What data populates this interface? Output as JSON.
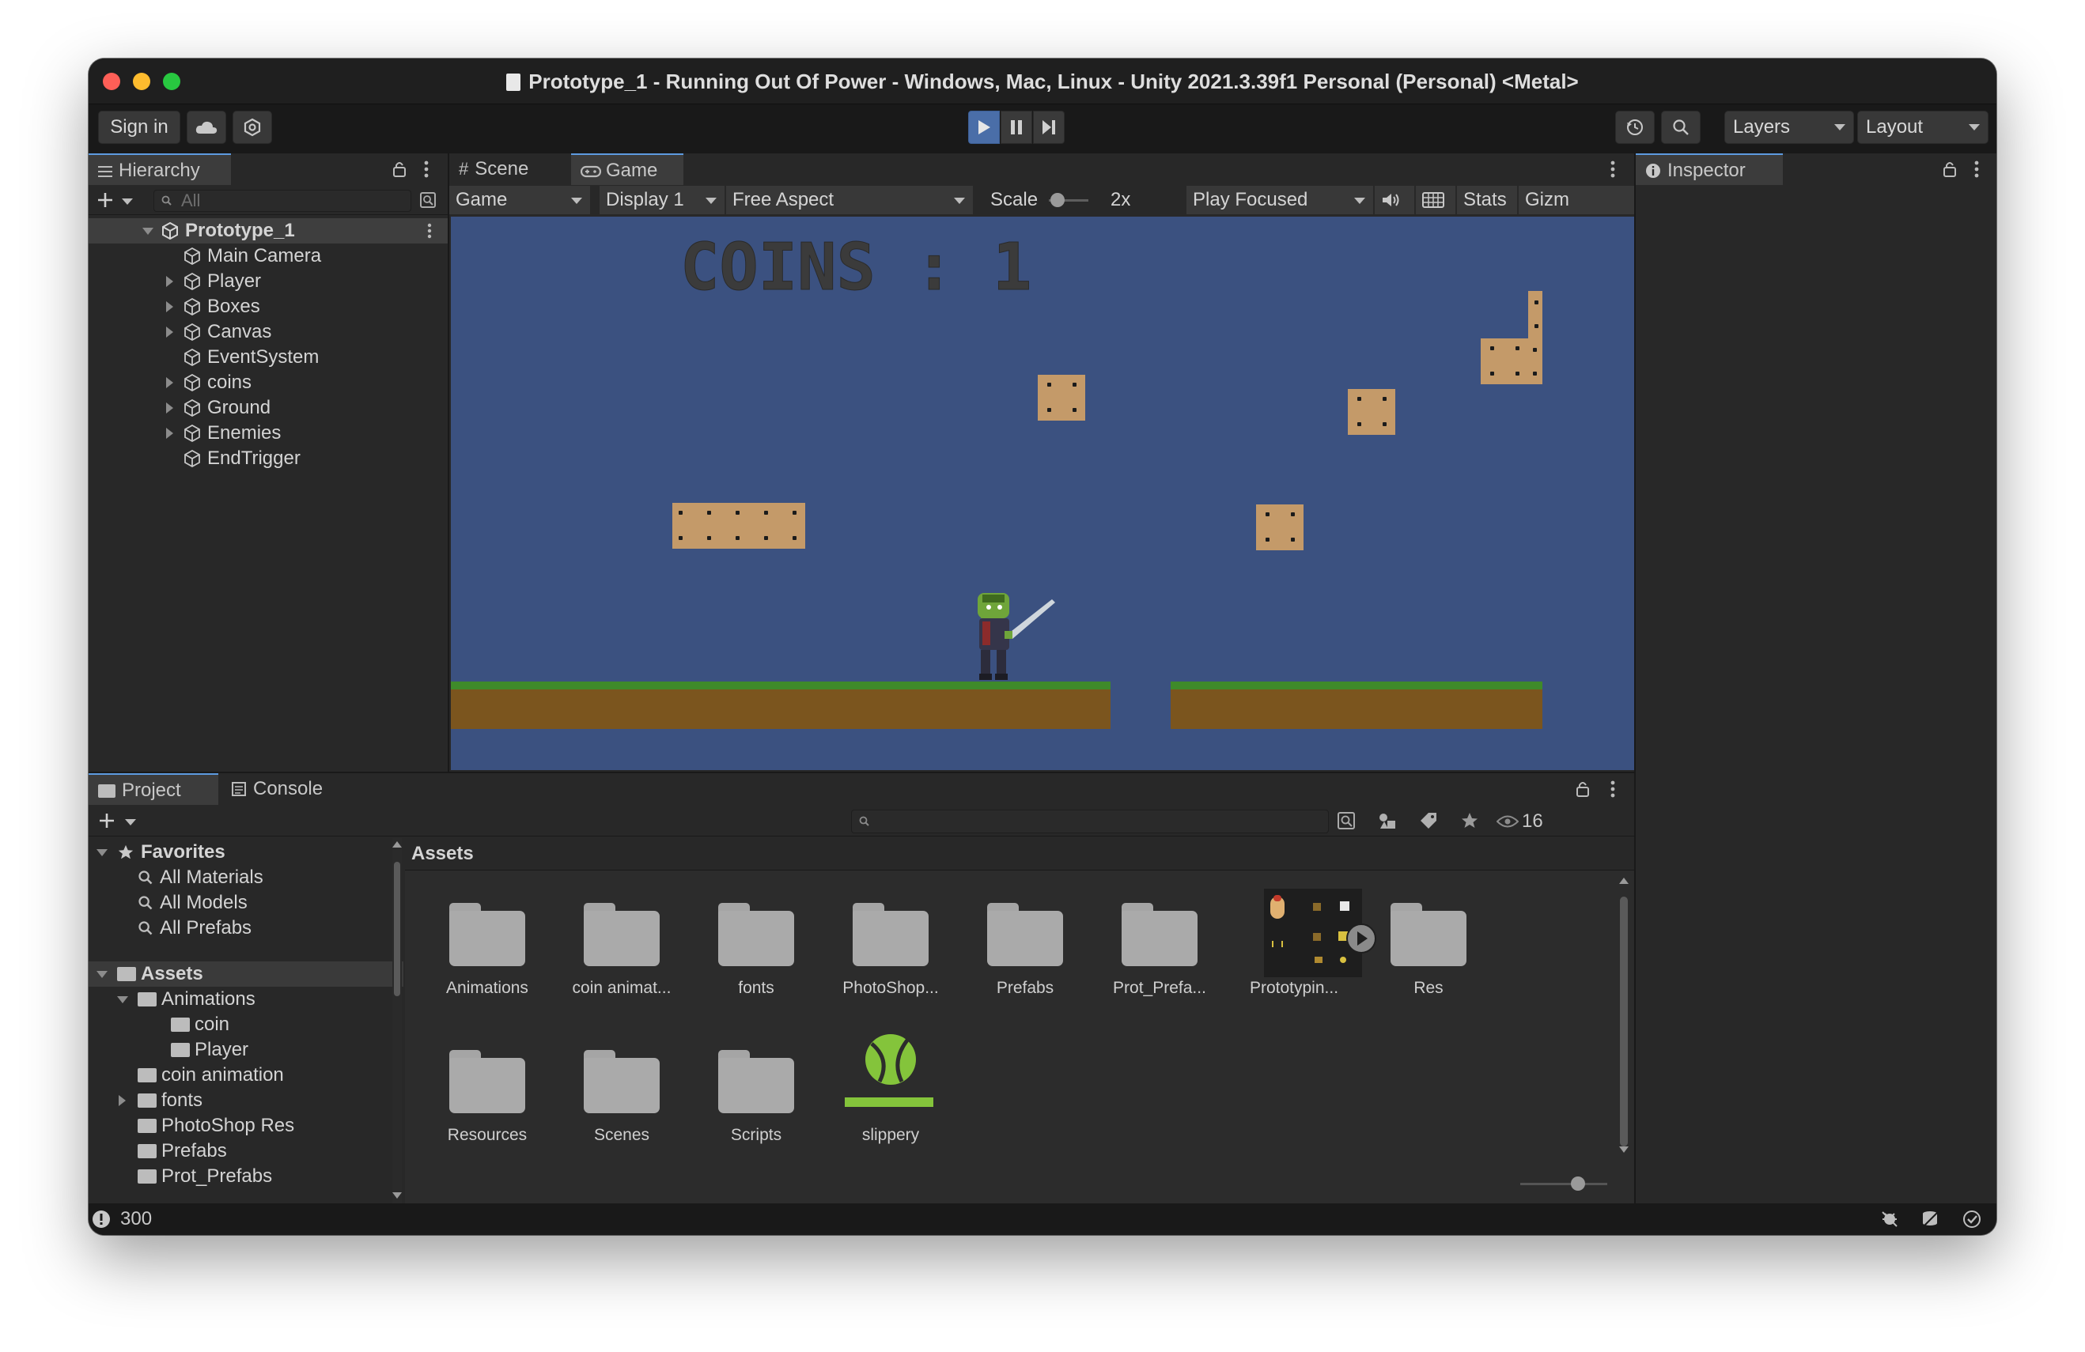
{
  "window": {
    "title": "Prototype_1 - Running Out Of Power - Windows, Mac, Linux - Unity 2021.3.39f1 Personal (Personal) <Metal>"
  },
  "toolbar": {
    "sign_in": "Sign in",
    "layers": "Layers",
    "layout": "Layout"
  },
  "hierarchy": {
    "tab": "Hierarchy",
    "search_placeholder": "All",
    "scene_name": "Prototype_1",
    "items": [
      {
        "label": "Main Camera",
        "expandable": false
      },
      {
        "label": "Player",
        "expandable": true
      },
      {
        "label": "Boxes",
        "expandable": true
      },
      {
        "label": "Canvas",
        "expandable": true
      },
      {
        "label": "EventSystem",
        "expandable": false
      },
      {
        "label": "coins",
        "expandable": true
      },
      {
        "label": "Ground",
        "expandable": true
      },
      {
        "label": "Enemies",
        "expandable": true
      },
      {
        "label": "EndTrigger",
        "expandable": false
      }
    ]
  },
  "game_view": {
    "tabs": [
      "Scene",
      "Game"
    ],
    "active_tab": "Game",
    "mode": "Game",
    "display": "Display 1",
    "aspect": "Free Aspect",
    "scale_label": "Scale",
    "scale_value": "2x",
    "play_mode": "Play Focused",
    "stats": "Stats",
    "gizmos": "Gizm",
    "hud_text": "COINS : 1",
    "sky_color": "#3b5180",
    "grass_color": "#3f8a2a",
    "dirt_color": "#7b551e",
    "box_color": "#c49a69"
  },
  "inspector": {
    "tab": "Inspector"
  },
  "project": {
    "tabs": [
      "Project",
      "Console"
    ],
    "hidden_count": "16",
    "breadcrumb": "Assets",
    "favorites": {
      "label": "Favorites",
      "items": [
        "All Materials",
        "All Models",
        "All Prefabs"
      ]
    },
    "tree": {
      "root": "Assets",
      "items": [
        {
          "label": "Animations",
          "depth": 1,
          "expanded": true
        },
        {
          "label": "coin",
          "depth": 2
        },
        {
          "label": "Player",
          "depth": 2
        },
        {
          "label": "coin animation",
          "depth": 1
        },
        {
          "label": "fonts",
          "depth": 1,
          "expandable": true
        },
        {
          "label": "PhotoShop Res",
          "depth": 1
        },
        {
          "label": "Prefabs",
          "depth": 1
        },
        {
          "label": "Prot_Prefabs",
          "depth": 1
        }
      ]
    },
    "assets": [
      {
        "label": "Animations",
        "kind": "folder"
      },
      {
        "label": "coin animat...",
        "kind": "folder"
      },
      {
        "label": "fonts",
        "kind": "folder"
      },
      {
        "label": "PhotoShop...",
        "kind": "folder"
      },
      {
        "label": "Prefabs",
        "kind": "folder"
      },
      {
        "label": "Prot_Prefa...",
        "kind": "folder"
      },
      {
        "label": "Prototypin...",
        "kind": "sprite-sheet"
      },
      {
        "label": "Res",
        "kind": "folder"
      },
      {
        "label": "Resources",
        "kind": "folder"
      },
      {
        "label": "Scenes",
        "kind": "folder"
      },
      {
        "label": "Scripts",
        "kind": "folder"
      },
      {
        "label": "slippery",
        "kind": "physics-material"
      }
    ]
  },
  "status_bar": {
    "warning_count": "300"
  }
}
